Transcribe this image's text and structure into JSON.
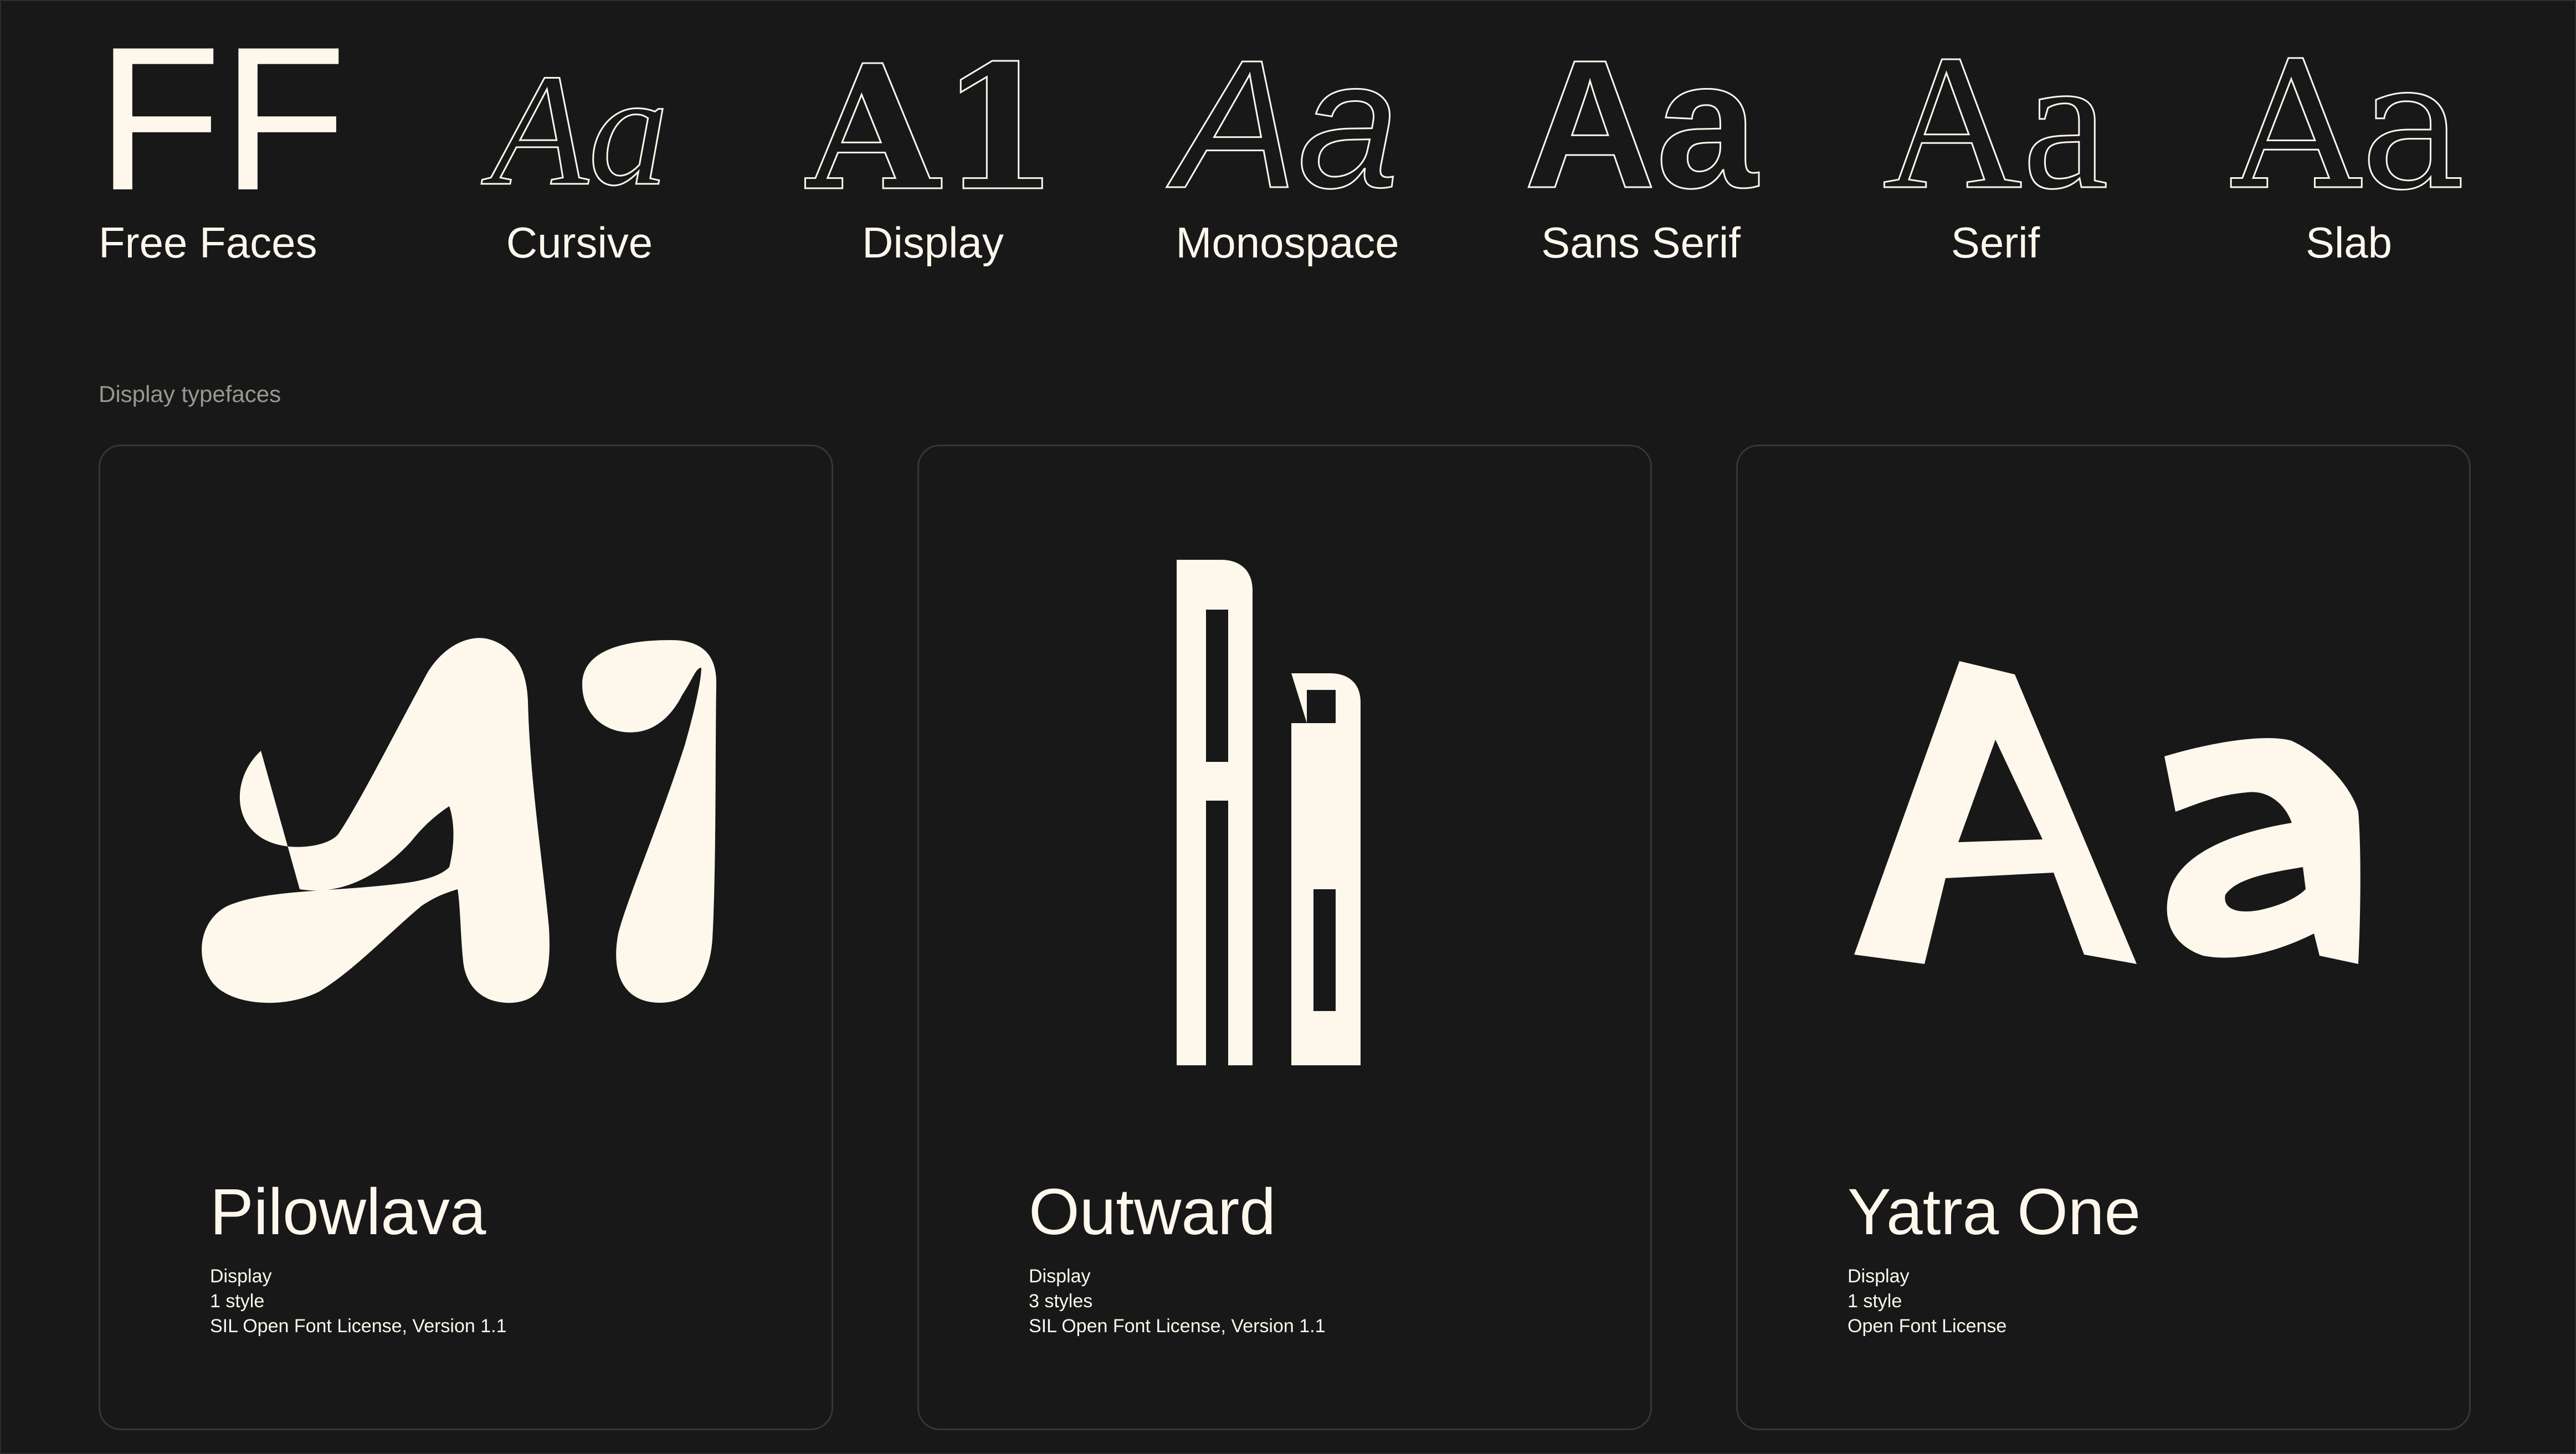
{
  "colors": {
    "background": "#181818",
    "foreground": "#fdf7ec",
    "muted": "#9a978f",
    "card_border": "#363636"
  },
  "nav": {
    "logo": {
      "glyph": "FF",
      "label": "Free Faces"
    },
    "categories": [
      {
        "glyph": "Aa",
        "label": "Cursive",
        "icon": "cursive-outline-icon"
      },
      {
        "glyph": "A1",
        "label": "Display",
        "icon": "display-outline-icon"
      },
      {
        "glyph": "Aa",
        "label": "Monospace",
        "icon": "monospace-outline-icon"
      },
      {
        "glyph": "Aa",
        "label": "Sans Serif",
        "icon": "sans-serif-outline-icon"
      },
      {
        "glyph": "Aa",
        "label": "Serif",
        "icon": "serif-outline-icon"
      },
      {
        "glyph": "Aa",
        "label": "Slab",
        "icon": "slab-outline-icon"
      }
    ]
  },
  "section": {
    "title": "Display typefaces"
  },
  "cards": [
    {
      "name": "Pilowlava",
      "specimen": "A1",
      "category": "Display",
      "styles": "1 style",
      "license": "SIL Open Font License, Version 1.1"
    },
    {
      "name": "Outward",
      "specimen": "Aa",
      "category": "Display",
      "styles": "3 styles",
      "license": "SIL Open Font License, Version 1.1"
    },
    {
      "name": "Yatra One",
      "specimen": "Aa",
      "category": "Display",
      "styles": "1 style",
      "license": "Open Font License"
    }
  ]
}
